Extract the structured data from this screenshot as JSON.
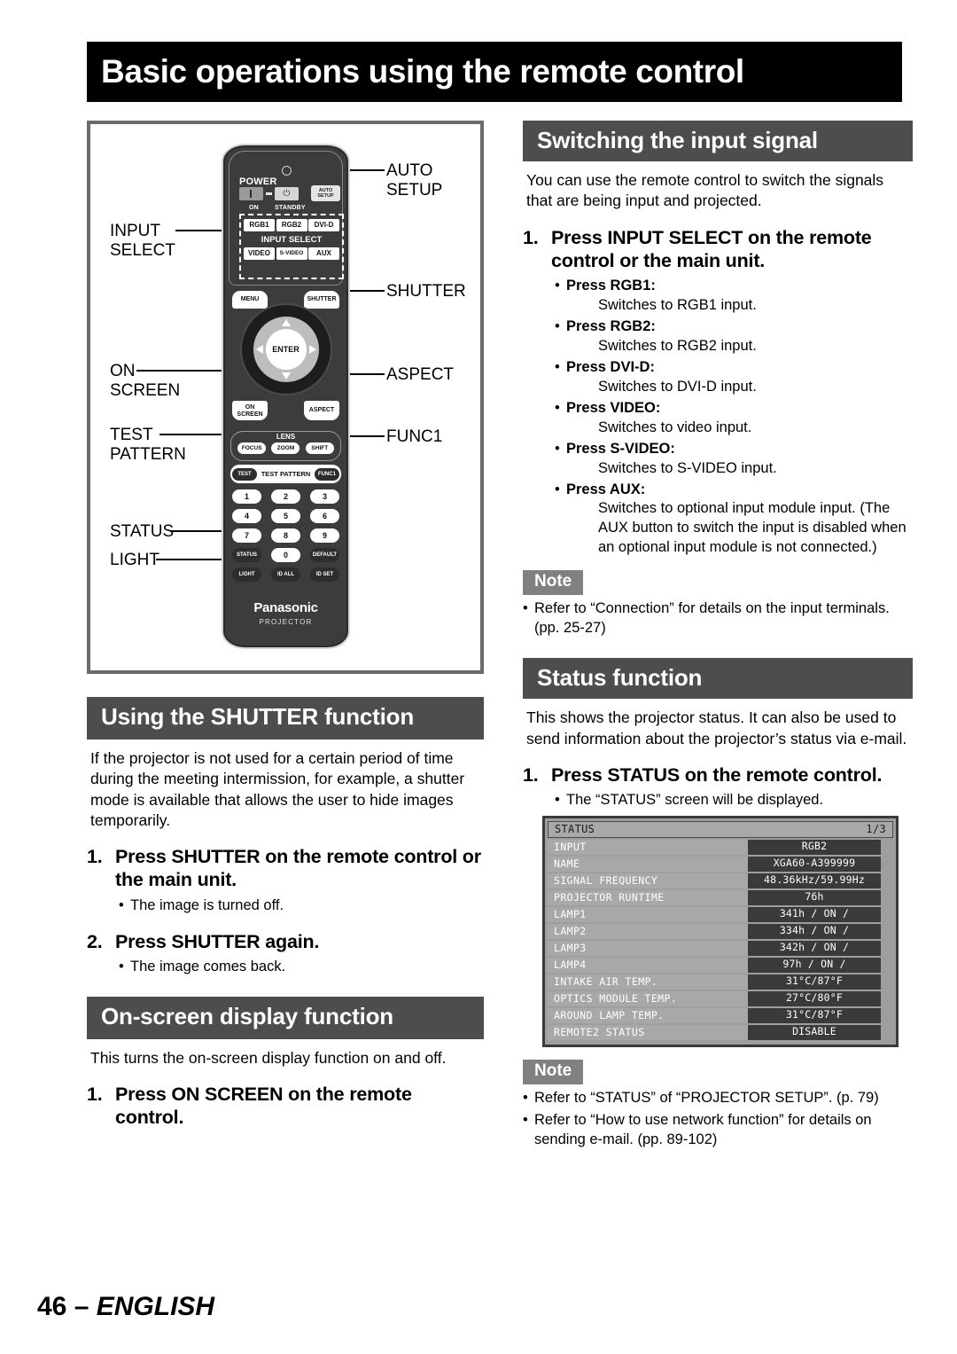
{
  "page": {
    "title": "Basic operations using the remote control",
    "footer_page_number": "46",
    "footer_separator": "–",
    "footer_language": "ENGLISH"
  },
  "remote_figure": {
    "callouts_left": [
      {
        "name": "input-select",
        "text": "INPUT\nSELECT"
      },
      {
        "name": "on-screen",
        "text": "ON\nSCREEN"
      },
      {
        "name": "test-pattern",
        "text": "TEST\nPATTERN"
      },
      {
        "name": "status",
        "text": "STATUS"
      },
      {
        "name": "light",
        "text": "LIGHT"
      }
    ],
    "callouts_right": [
      {
        "name": "auto-setup",
        "text": "AUTO\nSETUP"
      },
      {
        "name": "shutter",
        "text": "SHUTTER"
      },
      {
        "name": "aspect",
        "text": "ASPECT"
      },
      {
        "name": "func1",
        "text": "FUNC1"
      }
    ],
    "remote": {
      "power_label": "POWER",
      "on_label": "ON",
      "standby_label": "STANDBY",
      "standby_glyph": "⏻",
      "auto_setup_button": "AUTO\nSETUP",
      "input_select_caption": "INPUT SELECT",
      "input_buttons_row1": [
        "RGB1",
        "RGB2",
        "DVI-D"
      ],
      "input_buttons_row2": [
        "VIDEO",
        "S-VIDEO",
        "AUX"
      ],
      "menu_button": "MENU",
      "shutter_button": "SHUTTER",
      "enter_button": "ENTER",
      "on_screen_button": "ON\nSCREEN",
      "aspect_button": "ASPECT",
      "lens_caption": "LENS",
      "lens_buttons": [
        "FOCUS",
        "ZOOM",
        "SHIFT"
      ],
      "test_button": "TEST",
      "test_pattern_label": "TEST PATTERN",
      "func1_button": "FUNC1",
      "numpad_row1": [
        "1",
        "2",
        "3"
      ],
      "numpad_row2": [
        "4",
        "5",
        "6"
      ],
      "numpad_row3": [
        "7",
        "8",
        "9"
      ],
      "numpad_row4": [
        "STATUS",
        "0",
        "DEFAULT"
      ],
      "numpad_row5": [
        "LIGHT",
        "ID ALL",
        "ID SET"
      ],
      "brand": "Panasonic",
      "brand_sub": "PROJECTOR"
    }
  },
  "shutter_section": {
    "heading": "Using the SHUTTER function",
    "intro": "If the projector is not used for a certain period of time during the meeting intermission, for example, a shutter mode is available that allows the user to hide images temporarily.",
    "steps": [
      {
        "num": "1.",
        "text": "Press SHUTTER on the remote control or the main unit.",
        "bullet": "The image is turned off."
      },
      {
        "num": "2.",
        "text": "Press SHUTTER again.",
        "bullet": "The image comes back."
      }
    ]
  },
  "onscreen_section": {
    "heading": "On-screen display function",
    "intro": "This turns the on-screen display function on and off.",
    "steps": [
      {
        "num": "1.",
        "text": "Press ON SCREEN on the remote control."
      }
    ]
  },
  "switching_section": {
    "heading": "Switching the input signal",
    "intro": "You can use the remote control to switch the signals that are being input and projected.",
    "step_num": "1.",
    "step_text": "Press INPUT SELECT on the remote control or the main unit.",
    "bullets": [
      {
        "label": "Press RGB1:",
        "desc": "Switches to RGB1 input."
      },
      {
        "label": "Press RGB2:",
        "desc": "Switches to RGB2 input."
      },
      {
        "label": "Press DVI-D:",
        "desc": "Switches to DVI-D input."
      },
      {
        "label": "Press VIDEO:",
        "desc": "Switches to video input."
      },
      {
        "label": "Press S-VIDEO:",
        "desc": "Switches to S-VIDEO input."
      },
      {
        "label": "Press AUX:",
        "desc": "Switches to optional input module input. (The AUX button to switch the input is disabled when an optional input module is not connected.)"
      }
    ],
    "note_label": "Note",
    "notes": [
      "Refer to “Connection” for details on the input terminals. (pp. 25-27)"
    ]
  },
  "status_section": {
    "heading": "Status function",
    "intro": "This shows the projector status. It can also be used to send information about the projector’s status via e-mail.",
    "step_num": "1.",
    "step_text": "Press STATUS on the remote control.",
    "step_bullet": "The “STATUS” screen will be displayed.",
    "note_label": "Note",
    "notes": [
      "Refer to “STATUS” of “PROJECTOR SETUP”. (p. 79)",
      "Refer to “How to use network function” for details on sending e-mail. (pp. 89-102)"
    ]
  },
  "status_screen": {
    "title": "STATUS",
    "page_indicator": "1/3",
    "rows": [
      {
        "label": "INPUT",
        "value": "RGB2"
      },
      {
        "label": "NAME",
        "value": "XGA60-A399999"
      },
      {
        "label": "SIGNAL FREQUENCY",
        "value": "48.36kHz/59.99Hz"
      },
      {
        "label": "PROJECTOR RUNTIME",
        "value": "76h"
      },
      {
        "label": "LAMP1",
        "value": "341h / ON /"
      },
      {
        "label": "LAMP2",
        "value": "334h / ON /"
      },
      {
        "label": "LAMP3",
        "value": "342h / ON /"
      },
      {
        "label": "LAMP4",
        "value": "97h / ON /"
      },
      {
        "label": "INTAKE AIR TEMP.",
        "value": "31°C/87°F"
      },
      {
        "label": "OPTICS MODULE TEMP.",
        "value": "27°C/80°F"
      },
      {
        "label": "AROUND LAMP TEMP.",
        "value": "31°C/87°F"
      },
      {
        "label": "REMOTE2 STATUS",
        "value": "DISABLE"
      }
    ]
  },
  "colors": {
    "banner_bg": "#000000",
    "section_heading_bg": "#4d4d4d",
    "note_tag_bg": "#808080",
    "figure_border": "#6b6b6b",
    "status_row_label_bg": "#a8a8a8",
    "status_row_value_bg": "#3a3a3a"
  }
}
